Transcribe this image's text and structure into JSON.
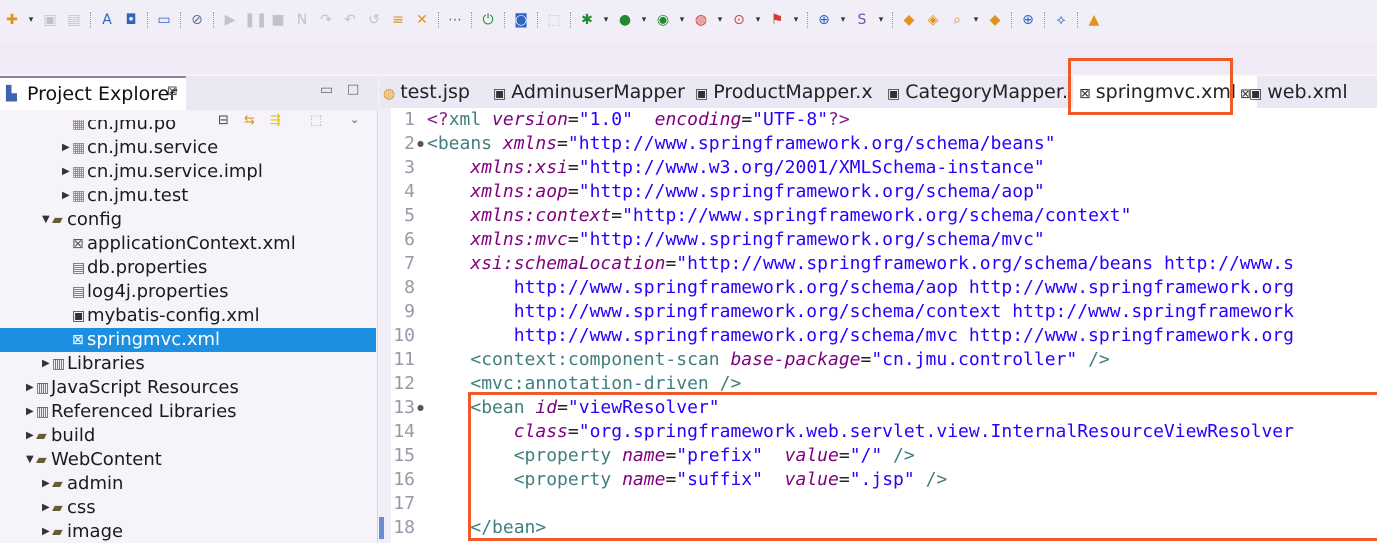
{
  "toolbar": {
    "icons": [
      "new-icon",
      "save-icon",
      "save-all-icon",
      "spell-icon",
      "export-icon",
      "monitor-icon",
      "skip-breakpoints-icon",
      "resume-icon",
      "suspend-icon",
      "terminate-icon",
      "step-into-icon",
      "step-over-icon",
      "step-return-icon",
      "list-icon",
      "debug-icon",
      "network-icon",
      "power-icon",
      "new-java-icon",
      "select-icon",
      "bug-icon",
      "run-icon",
      "coverage-icon",
      "external-tools-icon",
      "stop-icon",
      "deploy-icon",
      "globe-icon",
      "new-component-icon",
      "open-type-icon",
      "open-resource-icon",
      "search-icon",
      "open-task-icon",
      "web-browser-icon",
      "maven-icon",
      "perspective-icon"
    ]
  },
  "explorer": {
    "title": "Project Explorer",
    "close_glyph": "⊠",
    "tree": [
      {
        "label": "cn.jmu.po",
        "indent": 3,
        "type": "package",
        "twisty": ""
      },
      {
        "label": "cn.jmu.service",
        "indent": 3,
        "type": "package",
        "twisty": "▶"
      },
      {
        "label": "cn.jmu.service.impl",
        "indent": 3,
        "type": "package",
        "twisty": "▶"
      },
      {
        "label": "cn.jmu.test",
        "indent": 3,
        "type": "package",
        "twisty": "▶"
      },
      {
        "label": "config",
        "indent": 2,
        "type": "folder-open",
        "twisty": "▼"
      },
      {
        "label": "applicationContext.xml",
        "indent": 3,
        "type": "xml",
        "twisty": ""
      },
      {
        "label": "db.properties",
        "indent": 3,
        "type": "file",
        "twisty": ""
      },
      {
        "label": "log4j.properties",
        "indent": 3,
        "type": "file",
        "twisty": ""
      },
      {
        "label": "mybatis-config.xml",
        "indent": 3,
        "type": "xml-dark",
        "twisty": ""
      },
      {
        "label": "springmvc.xml",
        "indent": 3,
        "type": "xml",
        "twisty": "",
        "selected": true
      },
      {
        "label": "Libraries",
        "indent": 2,
        "type": "library",
        "twisty": "▶"
      },
      {
        "label": "JavaScript Resources",
        "indent": 1,
        "type": "library",
        "twisty": "▶"
      },
      {
        "label": "Referenced Libraries",
        "indent": 1,
        "type": "library",
        "twisty": "▶"
      },
      {
        "label": "build",
        "indent": 1,
        "type": "folder",
        "twisty": "▶"
      },
      {
        "label": "WebContent",
        "indent": 1,
        "type": "folder-open",
        "twisty": "▼"
      },
      {
        "label": "admin",
        "indent": 2,
        "type": "folder",
        "twisty": "▶"
      },
      {
        "label": "css",
        "indent": 2,
        "type": "folder",
        "twisty": "▶"
      },
      {
        "label": "image",
        "indent": 2,
        "type": "folder",
        "twisty": "▶"
      }
    ]
  },
  "editor": {
    "tabs": [
      {
        "label": "test.jsp",
        "icon": "jsp-icon",
        "active": false
      },
      {
        "label": "AdminuserMapper",
        "icon": "java-icon",
        "active": false
      },
      {
        "label": "ProductMapper.x",
        "icon": "java-icon",
        "active": false
      },
      {
        "label": "CategoryMapper.",
        "icon": "java-icon",
        "active": false
      },
      {
        "label": "springmvc.xml",
        "icon": "xml-icon",
        "active": true,
        "close": "⊠"
      },
      {
        "label": "web.xml",
        "icon": "java-icon",
        "active": false
      }
    ],
    "lines": [
      {
        "n": "1",
        "fold": "",
        "parts": [
          [
            "pi",
            "<?"
          ],
          [
            "tag",
            "xml "
          ],
          [
            "attr",
            "version"
          ],
          [
            "",
            "="
          ],
          [
            "val",
            "\"1.0\""
          ],
          [
            "",
            "  "
          ],
          [
            "attr",
            "encoding"
          ],
          [
            "",
            "="
          ],
          [
            "val",
            "\"UTF-8\""
          ],
          [
            "pi",
            "?>"
          ]
        ]
      },
      {
        "n": "2",
        "fold": "●",
        "parts": [
          [
            "tag",
            "<beans "
          ],
          [
            "attr",
            "xmlns"
          ],
          [
            "",
            "="
          ],
          [
            "val",
            "\"http://www.springframework.org/schema/beans\""
          ]
        ]
      },
      {
        "n": "3",
        "fold": "",
        "parts": [
          [
            "",
            "    "
          ],
          [
            "attr",
            "xmlns:xsi"
          ],
          [
            "",
            "="
          ],
          [
            "val",
            "\"http://www.w3.org/2001/XMLSchema-instance\""
          ]
        ]
      },
      {
        "n": "4",
        "fold": "",
        "parts": [
          [
            "",
            "    "
          ],
          [
            "attr",
            "xmlns:aop"
          ],
          [
            "",
            "="
          ],
          [
            "val",
            "\"http://www.springframework.org/schema/aop\""
          ]
        ]
      },
      {
        "n": "5",
        "fold": "",
        "parts": [
          [
            "",
            "    "
          ],
          [
            "attr",
            "xmlns:context"
          ],
          [
            "",
            "="
          ],
          [
            "val",
            "\"http://www.springframework.org/schema/context\""
          ]
        ]
      },
      {
        "n": "6",
        "fold": "",
        "parts": [
          [
            "",
            "    "
          ],
          [
            "attr",
            "xmlns:mvc"
          ],
          [
            "",
            "="
          ],
          [
            "val",
            "\"http://www.springframework.org/schema/mvc\""
          ]
        ]
      },
      {
        "n": "7",
        "fold": "",
        "parts": [
          [
            "",
            "    "
          ],
          [
            "attr",
            "xsi:schemaLocation"
          ],
          [
            "",
            "="
          ],
          [
            "val",
            "\"http://www.springframework.org/schema/beans http://www.s"
          ]
        ]
      },
      {
        "n": "8",
        "fold": "",
        "parts": [
          [
            "",
            "        "
          ],
          [
            "val",
            "http://www.springframework.org/schema/aop http://www.springframework.org"
          ]
        ]
      },
      {
        "n": "9",
        "fold": "",
        "parts": [
          [
            "",
            "        "
          ],
          [
            "val",
            "http://www.springframework.org/schema/context http://www.springframework"
          ]
        ]
      },
      {
        "n": "10",
        "fold": "",
        "parts": [
          [
            "",
            "        "
          ],
          [
            "val",
            "http://www.springframework.org/schema/mvc http://www.springframework.org"
          ]
        ]
      },
      {
        "n": "11",
        "fold": "",
        "parts": [
          [
            "",
            "    "
          ],
          [
            "tag",
            "<context:component-scan "
          ],
          [
            "attr",
            "base-package"
          ],
          [
            "",
            "="
          ],
          [
            "val",
            "\"cn.jmu.controller\""
          ],
          [
            "tag",
            " />"
          ]
        ]
      },
      {
        "n": "12",
        "fold": "",
        "parts": [
          [
            "",
            "    "
          ],
          [
            "tag",
            "<mvc:annotation-driven />"
          ]
        ]
      },
      {
        "n": "13",
        "fold": "●",
        "parts": [
          [
            "",
            "    "
          ],
          [
            "tag",
            "<bean "
          ],
          [
            "attr",
            "id"
          ],
          [
            "",
            "="
          ],
          [
            "val",
            "\"viewResolver\""
          ]
        ]
      },
      {
        "n": "14",
        "fold": "",
        "parts": [
          [
            "",
            "        "
          ],
          [
            "attr",
            "class"
          ],
          [
            "",
            "="
          ],
          [
            "val",
            "\"org.springframework.web.servlet.view.InternalResourceViewResolver"
          ]
        ]
      },
      {
        "n": "15",
        "fold": "",
        "parts": [
          [
            "",
            "        "
          ],
          [
            "tag",
            "<property "
          ],
          [
            "attr",
            "name"
          ],
          [
            "",
            "="
          ],
          [
            "val",
            "\"prefix\""
          ],
          [
            "",
            "  "
          ],
          [
            "attr",
            "value"
          ],
          [
            "",
            "="
          ],
          [
            "val",
            "\"/\""
          ],
          [
            "tag",
            " />"
          ]
        ]
      },
      {
        "n": "16",
        "fold": "",
        "parts": [
          [
            "",
            "        "
          ],
          [
            "tag",
            "<property "
          ],
          [
            "attr",
            "name"
          ],
          [
            "",
            "="
          ],
          [
            "val",
            "\"suffix\""
          ],
          [
            "",
            "  "
          ],
          [
            "attr",
            "value"
          ],
          [
            "",
            "="
          ],
          [
            "val",
            "\".jsp\""
          ],
          [
            "tag",
            " />"
          ]
        ]
      },
      {
        "n": "17",
        "fold": "",
        "parts": []
      },
      {
        "n": "18",
        "fold": "",
        "parts": [
          [
            "",
            "    "
          ],
          [
            "tag",
            "</bean>"
          ]
        ]
      }
    ]
  },
  "colors": {
    "accent": "#f05a28",
    "selection": "#1d8fe0"
  }
}
